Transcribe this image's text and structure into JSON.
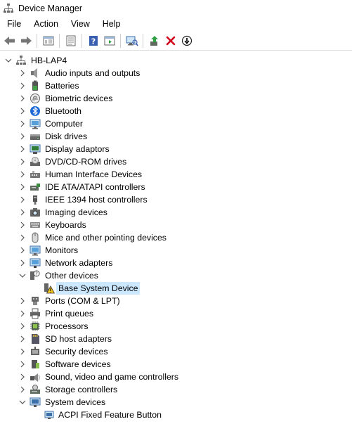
{
  "window": {
    "title": "Device Manager"
  },
  "menu": [
    "File",
    "Action",
    "View",
    "Help"
  ],
  "toolbar": [
    {
      "icon": "back-arrow-icon"
    },
    {
      "icon": "forward-arrow-icon"
    },
    {
      "sep": true
    },
    {
      "icon": "show-hide-console-tree-icon"
    },
    {
      "sep": true
    },
    {
      "icon": "properties-icon"
    },
    {
      "sep": true
    },
    {
      "icon": "help-icon"
    },
    {
      "icon": "action-pane-icon"
    },
    {
      "sep": true
    },
    {
      "icon": "scan-hardware-changes-icon"
    },
    {
      "sep": true
    },
    {
      "icon": "update-driver-icon"
    },
    {
      "icon": "uninstall-device-icon"
    },
    {
      "icon": "disable-device-icon"
    }
  ],
  "tree": {
    "root": {
      "label": "HB-LAP4",
      "icon": "computer-root-icon",
      "expanded": true
    },
    "categories": [
      {
        "label": "Audio inputs and outputs",
        "icon": "speaker-icon"
      },
      {
        "label": "Batteries",
        "icon": "battery-icon"
      },
      {
        "label": "Biometric devices",
        "icon": "fingerprint-icon"
      },
      {
        "label": "Bluetooth",
        "icon": "bluetooth-icon"
      },
      {
        "label": "Computer",
        "icon": "monitor-icon"
      },
      {
        "label": "Disk drives",
        "icon": "disk-drive-icon"
      },
      {
        "label": "Display adaptors",
        "icon": "display-adapter-icon"
      },
      {
        "label": "DVD/CD-ROM drives",
        "icon": "dvd-drive-icon"
      },
      {
        "label": "Human Interface Devices",
        "icon": "hid-icon"
      },
      {
        "label": "IDE ATA/ATAPI controllers",
        "icon": "ide-controller-icon"
      },
      {
        "label": "IEEE 1394 host controllers",
        "icon": "ieee1394-icon"
      },
      {
        "label": "Imaging devices",
        "icon": "camera-icon"
      },
      {
        "label": "Keyboards",
        "icon": "keyboard-icon"
      },
      {
        "label": "Mice and other pointing devices",
        "icon": "mouse-icon"
      },
      {
        "label": "Monitors",
        "icon": "monitor-icon"
      },
      {
        "label": "Network adapters",
        "icon": "network-adapter-icon"
      },
      {
        "label": "Other devices",
        "icon": "unknown-device-icon",
        "expanded": true,
        "children": [
          {
            "label": "Base System Device",
            "icon": "warning-device-icon",
            "selected": true
          }
        ]
      },
      {
        "label": "Ports (COM & LPT)",
        "icon": "port-icon"
      },
      {
        "label": "Print queues",
        "icon": "printer-icon"
      },
      {
        "label": "Processors",
        "icon": "processor-icon"
      },
      {
        "label": "SD host adapters",
        "icon": "sd-card-icon"
      },
      {
        "label": "Security devices",
        "icon": "security-device-icon"
      },
      {
        "label": "Software devices",
        "icon": "software-device-icon"
      },
      {
        "label": "Sound, video and game controllers",
        "icon": "sound-controller-icon"
      },
      {
        "label": "Storage controllers",
        "icon": "storage-controller-icon"
      },
      {
        "label": "System devices",
        "icon": "system-devices-icon",
        "expanded": true,
        "children": [
          {
            "label": "ACPI Fixed Feature Button",
            "icon": "system-device-icon"
          }
        ]
      }
    ]
  },
  "colors": {
    "selection": "#cce8ff",
    "chevron": "#555555",
    "delete": "#d0021b",
    "help_blue": "#3a5fb0"
  }
}
